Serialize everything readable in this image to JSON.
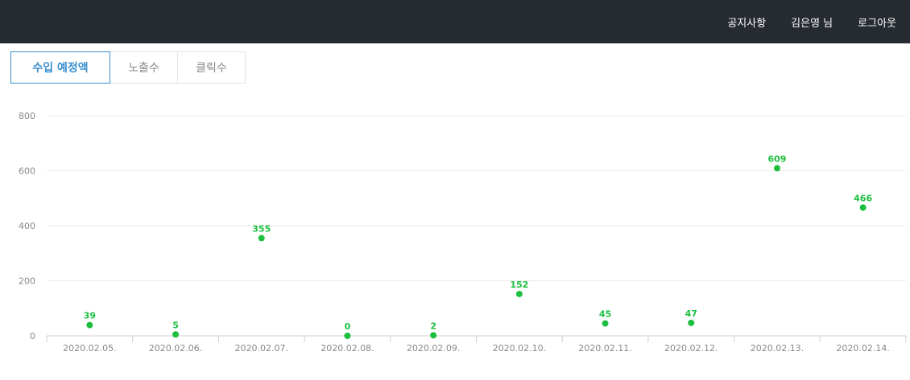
{
  "header": {
    "nav": [
      "공지사항",
      "김은영 님",
      "로그아웃"
    ]
  },
  "tabs": [
    {
      "label": "수입 예정액",
      "active": true
    },
    {
      "label": "노출수",
      "active": false
    },
    {
      "label": "클릭수",
      "active": false
    }
  ],
  "colors": {
    "header_bg": "#252b30",
    "accent": "#3a8fce",
    "series": "#1dbf3f"
  },
  "chart_data": {
    "type": "scatter",
    "categories": [
      "2020.02.05.",
      "2020.02.06.",
      "2020.02.07.",
      "2020.02.08.",
      "2020.02.09.",
      "2020.02.10.",
      "2020.02.11.",
      "2020.02.12.",
      "2020.02.13.",
      "2020.02.14."
    ],
    "values": [
      39,
      5,
      355,
      0,
      2,
      152,
      45,
      47,
      609,
      466
    ],
    "ylim": [
      0,
      800
    ],
    "yticks": [
      0,
      200,
      400,
      600,
      800
    ],
    "grid": true,
    "data_labels": true
  }
}
